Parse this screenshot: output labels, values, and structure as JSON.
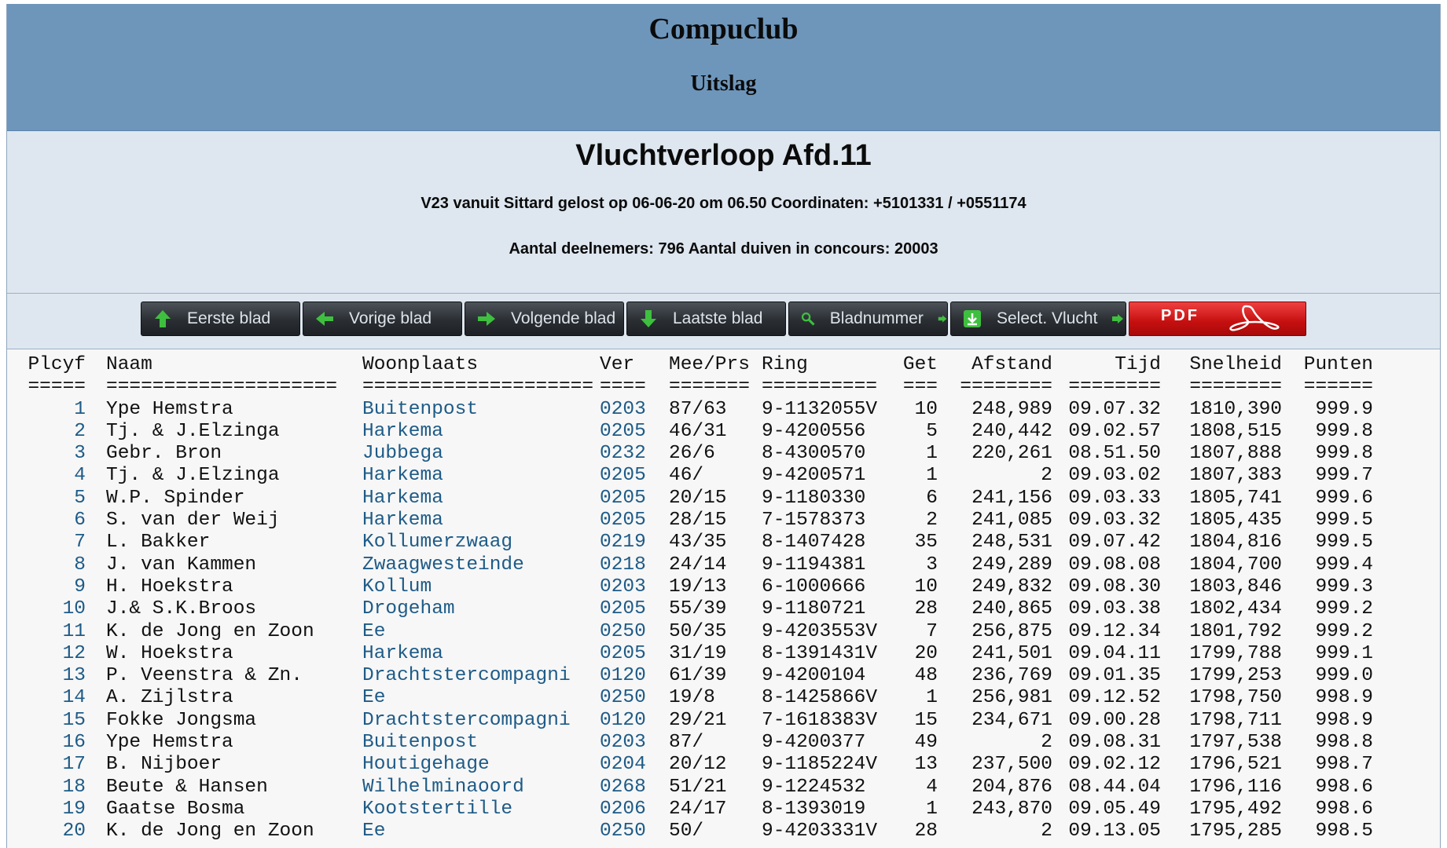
{
  "banner": {
    "club": "Compuclub",
    "subtitle": "Uitslag"
  },
  "flight": {
    "title": "Vluchtverloop Afd.11",
    "release": "V23 vanuit Sittard gelost op 06-06-20 om 06.50 Coordinaten: +5101331 / +0551174",
    "participants": "Aantal deelnemers: 796 Aantal duiven in concours: 20003"
  },
  "nav": {
    "buttons": [
      {
        "label": "Eerste blad",
        "icon": "arrow-up-icon"
      },
      {
        "label": "Vorige blad",
        "icon": "arrow-left-icon"
      },
      {
        "label": "Volgende blad",
        "icon": "arrow-right-icon"
      },
      {
        "label": "Laatste blad",
        "icon": "arrow-down-icon"
      },
      {
        "label": "Bladnummer",
        "icon": "magnifier-icon"
      },
      {
        "label": "Select. Vlucht",
        "icon": "download-icon"
      }
    ],
    "pdf_label": "PDF",
    "colors": {
      "accent_green": "#3fbf3f",
      "pdf_red": "#d91c1c",
      "banner_blue": "#6e96bb",
      "link_blue": "#1e5b87"
    }
  },
  "table": {
    "headers": [
      "Plcyf",
      "Naam",
      "Woonplaats",
      "Ver",
      "Mee/Prs",
      "Ring",
      "Get",
      "Afstand",
      "Tijd",
      "Snelheid",
      "Punten"
    ],
    "separators": [
      "=====",
      "====================",
      "====================",
      "====",
      "=======",
      "==========",
      "===",
      "========",
      "========",
      "========",
      "======"
    ],
    "rows": [
      [
        "1",
        "Ype Hemstra",
        "Buitenpost",
        "0203",
        "87/63",
        "9-1132055V",
        "10",
        "248,989",
        "09.07.32",
        "1810,390",
        "999.9"
      ],
      [
        "2",
        "Tj. & J.Elzinga",
        "Harkema",
        "0205",
        "46/31",
        "9-4200556",
        "5",
        "240,442",
        "09.02.57",
        "1808,515",
        "999.8"
      ],
      [
        "3",
        "Gebr. Bron",
        "Jubbega",
        "0232",
        "26/6",
        "8-4300570",
        "1",
        "220,261",
        "08.51.50",
        "1807,888",
        "999.8"
      ],
      [
        "4",
        "Tj. & J.Elzinga",
        "Harkema",
        "0205",
        "46/",
        "9-4200571",
        "1",
        "2",
        "09.03.02",
        "1807,383",
        "999.7"
      ],
      [
        "5",
        "W.P. Spinder",
        "Harkema",
        "0205",
        "20/15",
        "9-1180330",
        "6",
        "241,156",
        "09.03.33",
        "1805,741",
        "999.6"
      ],
      [
        "6",
        "S. van der Weij",
        "Harkema",
        "0205",
        "28/15",
        "7-1578373",
        "2",
        "241,085",
        "09.03.32",
        "1805,435",
        "999.5"
      ],
      [
        "7",
        "L. Bakker",
        "Kollumerzwaag",
        "0219",
        "43/35",
        "8-1407428",
        "35",
        "248,531",
        "09.07.42",
        "1804,816",
        "999.5"
      ],
      [
        "8",
        "J. van Kammen",
        "Zwaagwesteinde",
        "0218",
        "24/14",
        "9-1194381",
        "3",
        "249,289",
        "09.08.08",
        "1804,700",
        "999.4"
      ],
      [
        "9",
        "H. Hoekstra",
        "Kollum",
        "0203",
        "19/13",
        "6-1000666",
        "10",
        "249,832",
        "09.08.30",
        "1803,846",
        "999.3"
      ],
      [
        "10",
        "J.& S.K.Broos",
        "Drogeham",
        "0205",
        "55/39",
        "9-1180721",
        "28",
        "240,865",
        "09.03.38",
        "1802,434",
        "999.2"
      ],
      [
        "11",
        "K. de Jong en Zoon",
        "Ee",
        "0250",
        "50/35",
        "9-4203553V",
        "7",
        "256,875",
        "09.12.34",
        "1801,792",
        "999.2"
      ],
      [
        "12",
        "W. Hoekstra",
        "Harkema",
        "0205",
        "31/19",
        "8-1391431V",
        "20",
        "241,501",
        "09.04.11",
        "1799,788",
        "999.1"
      ],
      [
        "13",
        "P. Veenstra & Zn.",
        "Drachtstercompagni",
        "0120",
        "61/39",
        "9-4200104",
        "48",
        "236,769",
        "09.01.35",
        "1799,253",
        "999.0"
      ],
      [
        "14",
        "A. Zijlstra",
        "Ee",
        "0250",
        "19/8",
        "8-1425866V",
        "1",
        "256,981",
        "09.12.52",
        "1798,750",
        "998.9"
      ],
      [
        "15",
        "Fokke Jongsma",
        "Drachtstercompagni",
        "0120",
        "29/21",
        "7-1618383V",
        "15",
        "234,671",
        "09.00.28",
        "1798,711",
        "998.9"
      ],
      [
        "16",
        "Ype Hemstra",
        "Buitenpost",
        "0203",
        "87/",
        "9-4200377",
        "49",
        "2",
        "09.08.31",
        "1797,538",
        "998.8"
      ],
      [
        "17",
        "B. Nijboer",
        "Houtigehage",
        "0204",
        "20/12",
        "9-1185224V",
        "13",
        "237,500",
        "09.02.12",
        "1796,521",
        "998.7"
      ],
      [
        "18",
        "Beute & Hansen",
        "Wilhelminaoord",
        "0268",
        "51/21",
        "9-1224532",
        "4",
        "204,876",
        "08.44.04",
        "1796,116",
        "998.6"
      ],
      [
        "19",
        "Gaatse Bosma",
        "Kootstertille",
        "0206",
        "24/17",
        "8-1393019",
        "1",
        "243,870",
        "09.05.49",
        "1795,492",
        "998.6"
      ],
      [
        "20",
        "K. de Jong en Zoon",
        "Ee",
        "0250",
        "50/",
        "9-4203331V",
        "28",
        "2",
        "09.13.05",
        "1795,285",
        "998.5"
      ]
    ]
  }
}
